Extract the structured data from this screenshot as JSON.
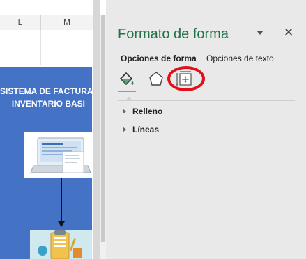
{
  "sheet": {
    "columns": [
      "L",
      "M"
    ]
  },
  "diagram": {
    "title_lines": [
      "SISTEMA DE FACTURA",
      "INVENTARIO BASI"
    ],
    "color": "#4472c4"
  },
  "pane": {
    "title": "Formato de forma",
    "close_glyph": "✕",
    "tabs": [
      {
        "label": "Opciones de forma",
        "active": true
      },
      {
        "label": "Opciones de texto",
        "active": false
      }
    ],
    "icons": [
      "fill-line-icon",
      "effects-icon",
      "size-properties-icon"
    ],
    "sections": [
      {
        "label": "Relleno"
      },
      {
        "label": "Líneas"
      }
    ],
    "accent": "#217346",
    "highlight": "#e0101c"
  }
}
